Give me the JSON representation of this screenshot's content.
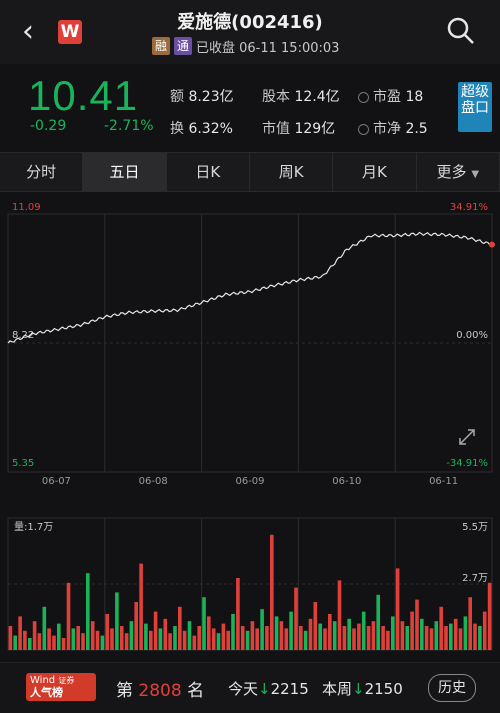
{
  "header": {
    "title": "爱施德(002416)",
    "logo": "W",
    "tag_rong": "融",
    "tag_tong": "通",
    "status": "已收盘 06-11 15:00:03"
  },
  "quote": {
    "price": "10.41",
    "change": "-0.29",
    "change_pct": "-2.71%",
    "amount_label": "额",
    "amount": "8.23亿",
    "turnover_label": "换",
    "turnover": "6.32%",
    "share_capital_label": "股本",
    "share_capital": "12.4亿",
    "mkt_cap_label": "市值",
    "mkt_cap": "129亿",
    "pe_label": "市盈",
    "pe": "18",
    "pb_label": "市净",
    "pb": "2.5",
    "super_button": "超级盘口",
    "colors": {
      "down": "#19b45a",
      "up": "#e0403a",
      "accent": "#1f84b8"
    }
  },
  "tabs": [
    "分时",
    "五日",
    "日K",
    "周K",
    "月K",
    "更多"
  ],
  "active_tab": "五日",
  "chart_data": [
    {
      "type": "line",
      "y_high_label": "11.09",
      "y_low_label": "5.35",
      "y_base_label": "8.22",
      "pct_high": "34.91%",
      "pct_zero": "0.00%",
      "pct_low": "-34.91%",
      "ylim": [
        5.35,
        11.09
      ],
      "x_labels": [
        "06-07",
        "06-08",
        "06-09",
        "06-10",
        "06-11"
      ],
      "x": [
        0,
        5,
        10,
        15,
        20,
        25,
        30,
        35,
        40,
        45,
        50,
        55,
        60,
        65,
        70,
        75,
        80,
        85,
        90,
        95,
        100
      ],
      "y": [
        8.22,
        8.42,
        8.52,
        8.62,
        8.8,
        8.9,
        8.93,
        8.95,
        9.12,
        9.3,
        9.36,
        9.5,
        9.62,
        9.7,
        10.3,
        10.61,
        10.61,
        10.65,
        10.63,
        10.56,
        10.41
      ],
      "grid": true
    },
    {
      "type": "bar",
      "ylabel": "量:1.7万",
      "y_top_label": "5.5万",
      "y_mid_label": "2.7万",
      "ylim": [
        0,
        5.5
      ],
      "values": [
        1.0,
        0.6,
        1.4,
        0.8,
        0.5,
        1.2,
        0.7,
        1.8,
        0.9,
        0.6,
        1.1,
        0.5,
        2.8,
        0.9,
        1.0,
        0.7,
        3.2,
        1.2,
        0.8,
        0.6,
        1.5,
        0.9,
        2.4,
        1.0,
        0.7,
        1.2,
        2.0,
        3.6,
        1.1,
        0.8,
        1.6,
        0.9,
        1.3,
        0.7,
        1.0,
        1.8,
        0.8,
        1.2,
        0.6,
        1.0,
        2.2,
        1.4,
        0.9,
        0.7,
        1.1,
        0.8,
        1.5,
        3.0,
        1.0,
        0.8,
        1.2,
        0.9,
        1.7,
        1.0,
        4.8,
        1.4,
        1.2,
        0.9,
        1.6,
        2.6,
        1.0,
        0.8,
        1.3,
        2.0,
        1.1,
        0.9,
        1.5,
        1.2,
        2.9,
        1.0,
        1.3,
        0.9,
        1.1,
        1.6,
        1.0,
        1.2,
        2.3,
        1.0,
        0.8,
        1.4,
        3.4,
        1.2,
        1.0,
        1.6,
        2.1,
        1.3,
        1.0,
        0.9,
        1.2,
        1.8,
        1.0,
        1.1,
        1.3,
        0.9,
        1.4,
        2.2,
        1.1,
        1.0,
        1.6,
        2.8
      ]
    }
  ],
  "bottom": {
    "wind_brand": "Wind",
    "wind_sub": "证券",
    "wind_title": "人气榜",
    "rank_prefix": "第",
    "rank": "2808",
    "rank_suffix": "名",
    "today_label": "今天",
    "today": "2215",
    "week_label": "本周",
    "week": "2150",
    "history": "历史"
  }
}
